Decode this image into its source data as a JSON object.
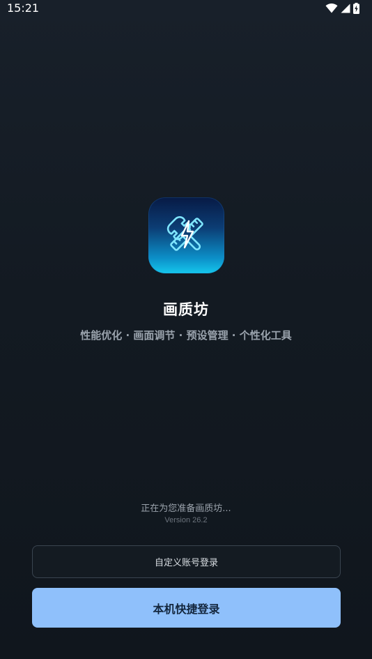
{
  "status_bar": {
    "time": "15:21",
    "icons": [
      "wifi-icon",
      "cellular-signal-icon",
      "battery-charging-icon"
    ]
  },
  "app": {
    "icon": "wrench-ruler-bolt-icon",
    "title": "画质坊",
    "subtitle": "性能优化 · 画面调节 · 预设管理 · 个性化工具"
  },
  "loading": {
    "message": "正在为您准备画质坊...",
    "version": "Version 26.2"
  },
  "buttons": {
    "custom_login_label": "自定义账号登录",
    "quick_login_label": "本机快捷登录"
  },
  "colors": {
    "background": "#131a22",
    "primary_button": "#8fc0fb",
    "primary_button_text": "#13263d",
    "icon_gradient_top": "#071a45",
    "icon_gradient_bottom": "#15c7ec"
  }
}
